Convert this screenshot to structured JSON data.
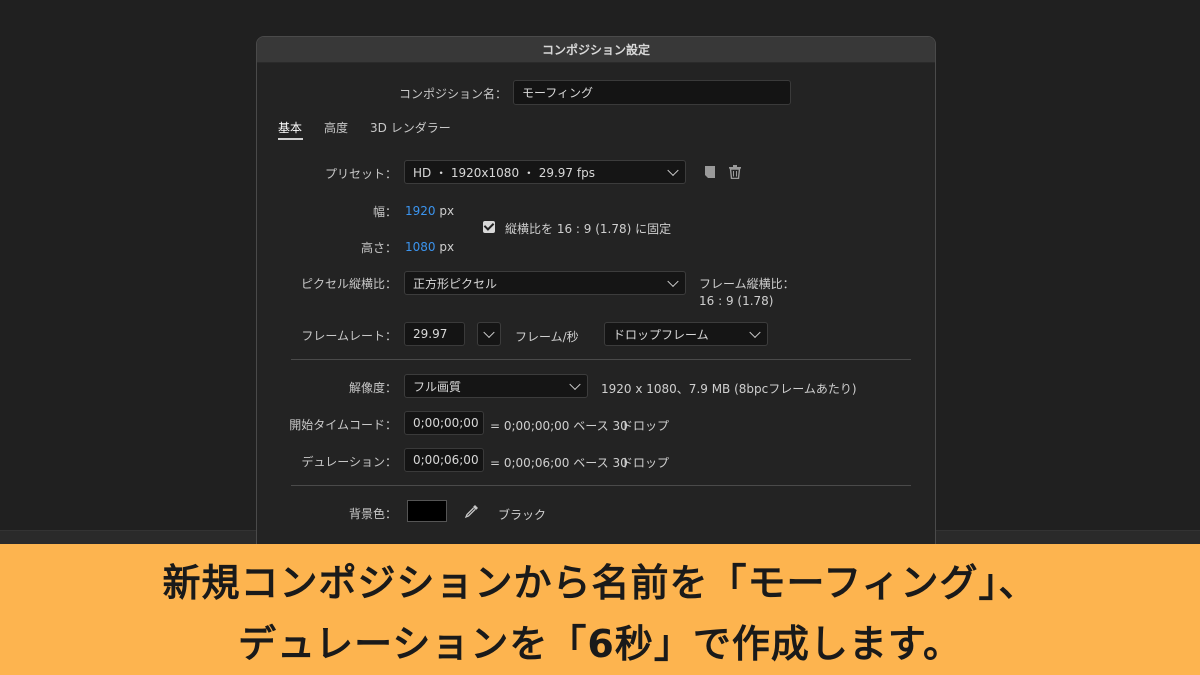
{
  "dialog": {
    "title": "コンポジション設定",
    "comp_name_label": "コンポジション名：",
    "comp_name_value": "モーフィング",
    "tabs": [
      "基本",
      "高度",
      "3D レンダラー"
    ],
    "preset_label": "プリセット：",
    "preset_value": "HD ・ 1920x1080 ・ 29.97 fps",
    "width_label": "幅：",
    "width_value": "1920",
    "width_unit": "px",
    "height_label": "高さ：",
    "height_value": "1080",
    "height_unit": "px",
    "aspect_lock_label": "縦横比を 16 : 9 (1.78) に固定",
    "aspect_lock_checked": true,
    "pixel_aspect_label": "ピクセル縦横比：",
    "pixel_aspect_value": "正方形ピクセル",
    "frame_aspect_label": "フレーム縦横比：",
    "frame_aspect_value": "16 : 9 (1.78)",
    "frame_rate_label": "フレームレート：",
    "frame_rate_value": "29.97",
    "frame_rate_unit": "フレーム/秒",
    "drop_frame_value": "ドロップフレーム",
    "resolution_label": "解像度：",
    "resolution_value": "フル画質",
    "resolution_info": "1920 x 1080、7.9 MB (8bpcフレームあたり)",
    "start_tc_label": "開始タイムコード：",
    "start_tc_value": "0;00;00;00",
    "start_tc_info": "= 0;00;00;00  ベース 30",
    "start_tc_drop": "ドロップ",
    "duration_label": "デュレーション：",
    "duration_value": "0;00;06;00",
    "duration_info": "= 0;00;06;00  ベース 30",
    "duration_drop": "ドロップ",
    "bg_color_label": "背景色：",
    "bg_color_name": "ブラック",
    "bg_color": "#000000",
    "accent_color": "#3b94ee"
  },
  "caption": {
    "line1": "新規コンポジションから名前を「モーフィング」、",
    "line2": "デュレーションを「6秒」で作成します。",
    "background": "#fdb44f"
  }
}
